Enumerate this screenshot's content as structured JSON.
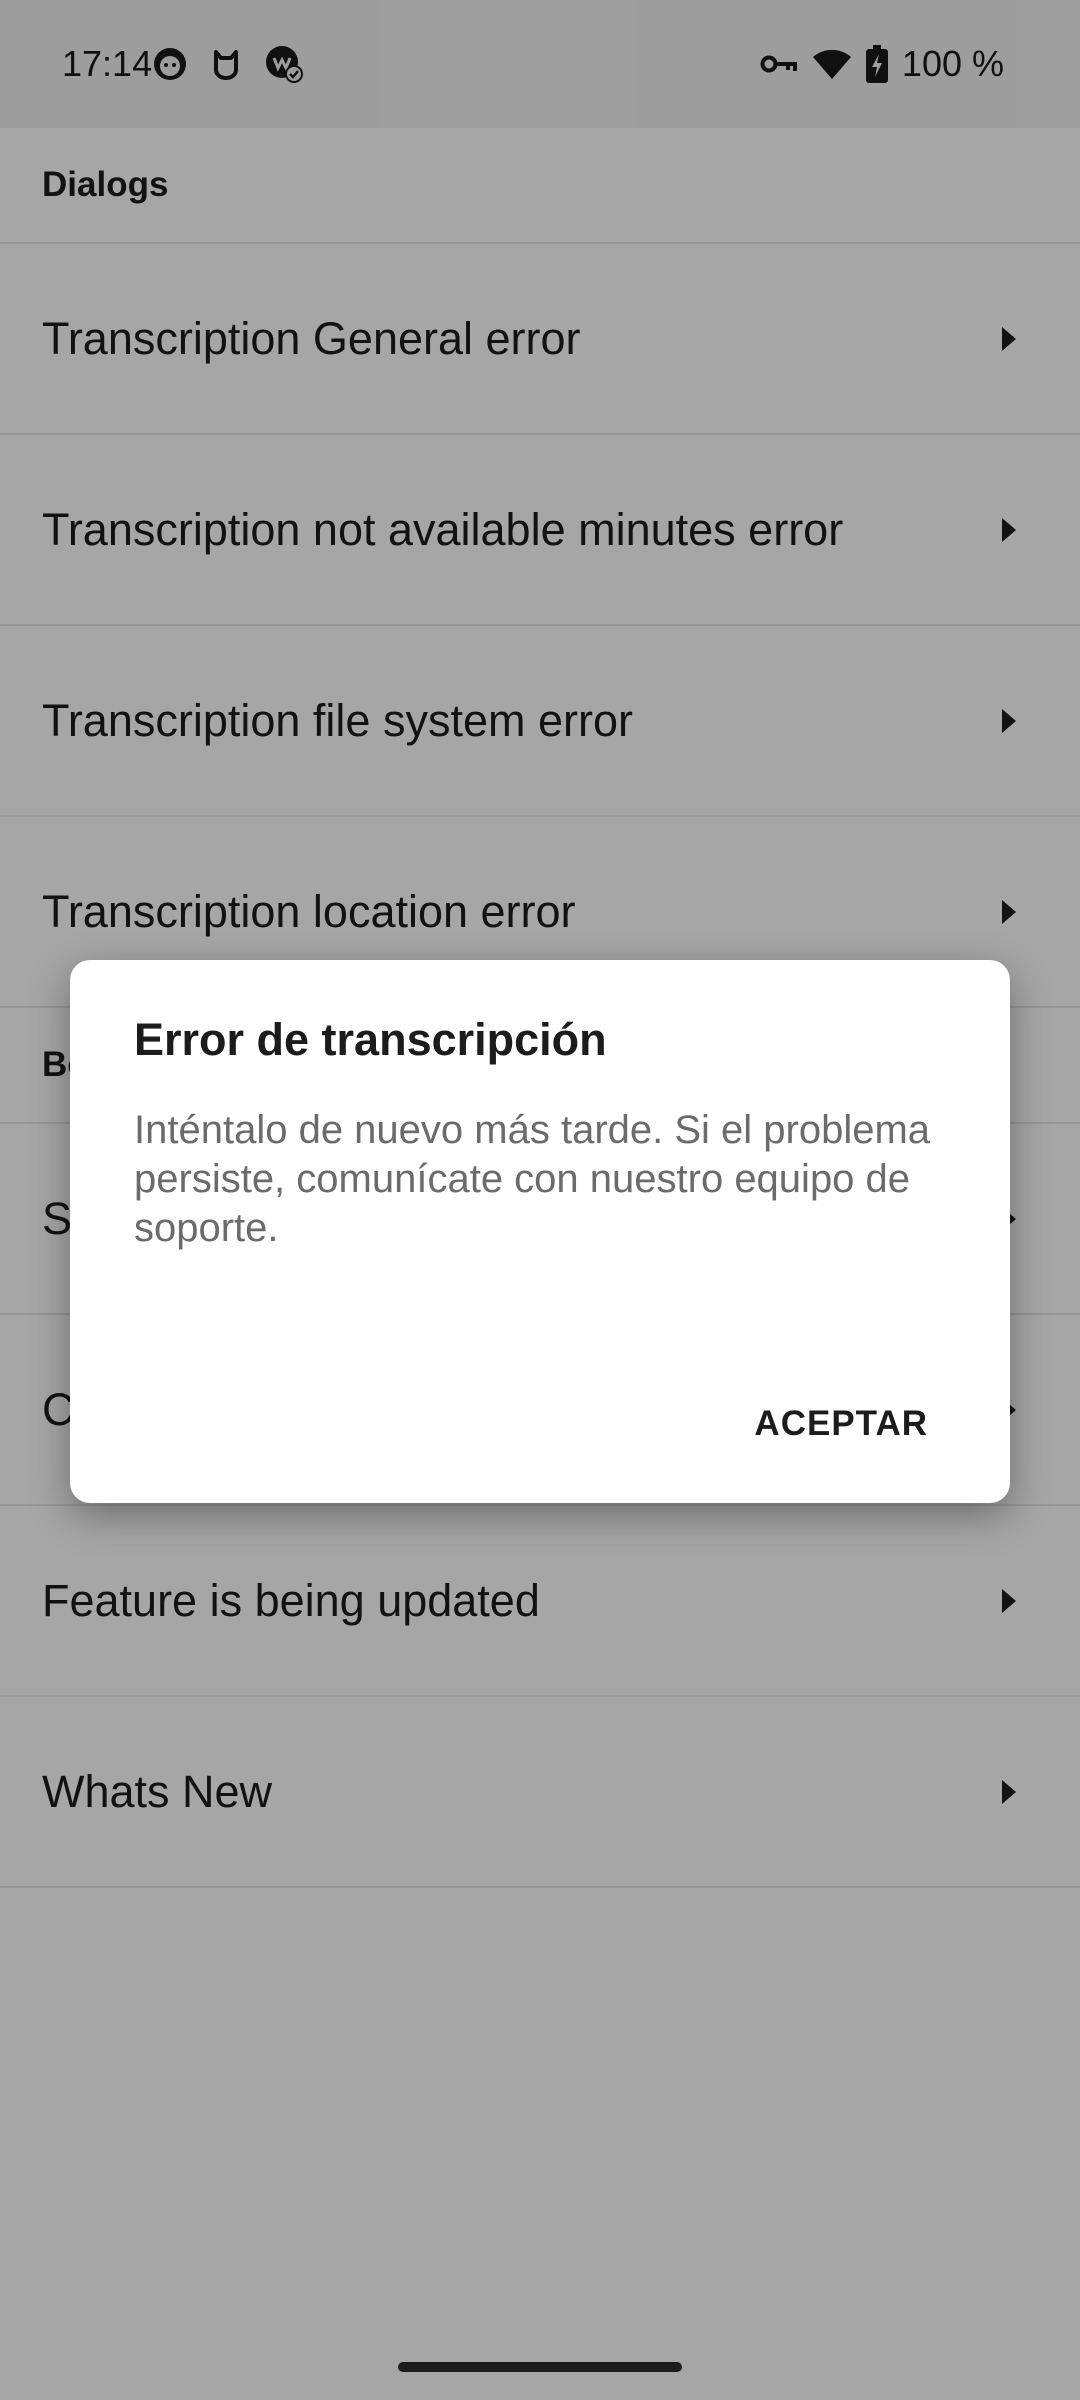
{
  "status_bar": {
    "time": "17:14",
    "battery_percent": "100 %",
    "left_icons": [
      "app-face-icon",
      "cat-icon",
      "badge-check-icon"
    ],
    "right_icons": [
      "vpn-key-icon",
      "wifi-icon",
      "battery-charging-icon"
    ]
  },
  "list": {
    "section_title": "Dialogs",
    "items": [
      {
        "label": "Transcription General error"
      },
      {
        "label": "Transcription not available minutes error"
      },
      {
        "label": "Transcription file system error"
      },
      {
        "label": "Transcription location error"
      }
    ],
    "section2_title": "Bo",
    "items2": [
      {
        "label": "S"
      },
      {
        "label": "C"
      },
      {
        "label": "Feature is being updated"
      },
      {
        "label": "Whats New"
      }
    ]
  },
  "dialog": {
    "title": "Error de transcripción",
    "message": "Inténtalo de nuevo más tarde. Si el problema persiste, comunícate con nuestro equipo de soporte.",
    "confirm_label": "ACEPTAR"
  }
}
